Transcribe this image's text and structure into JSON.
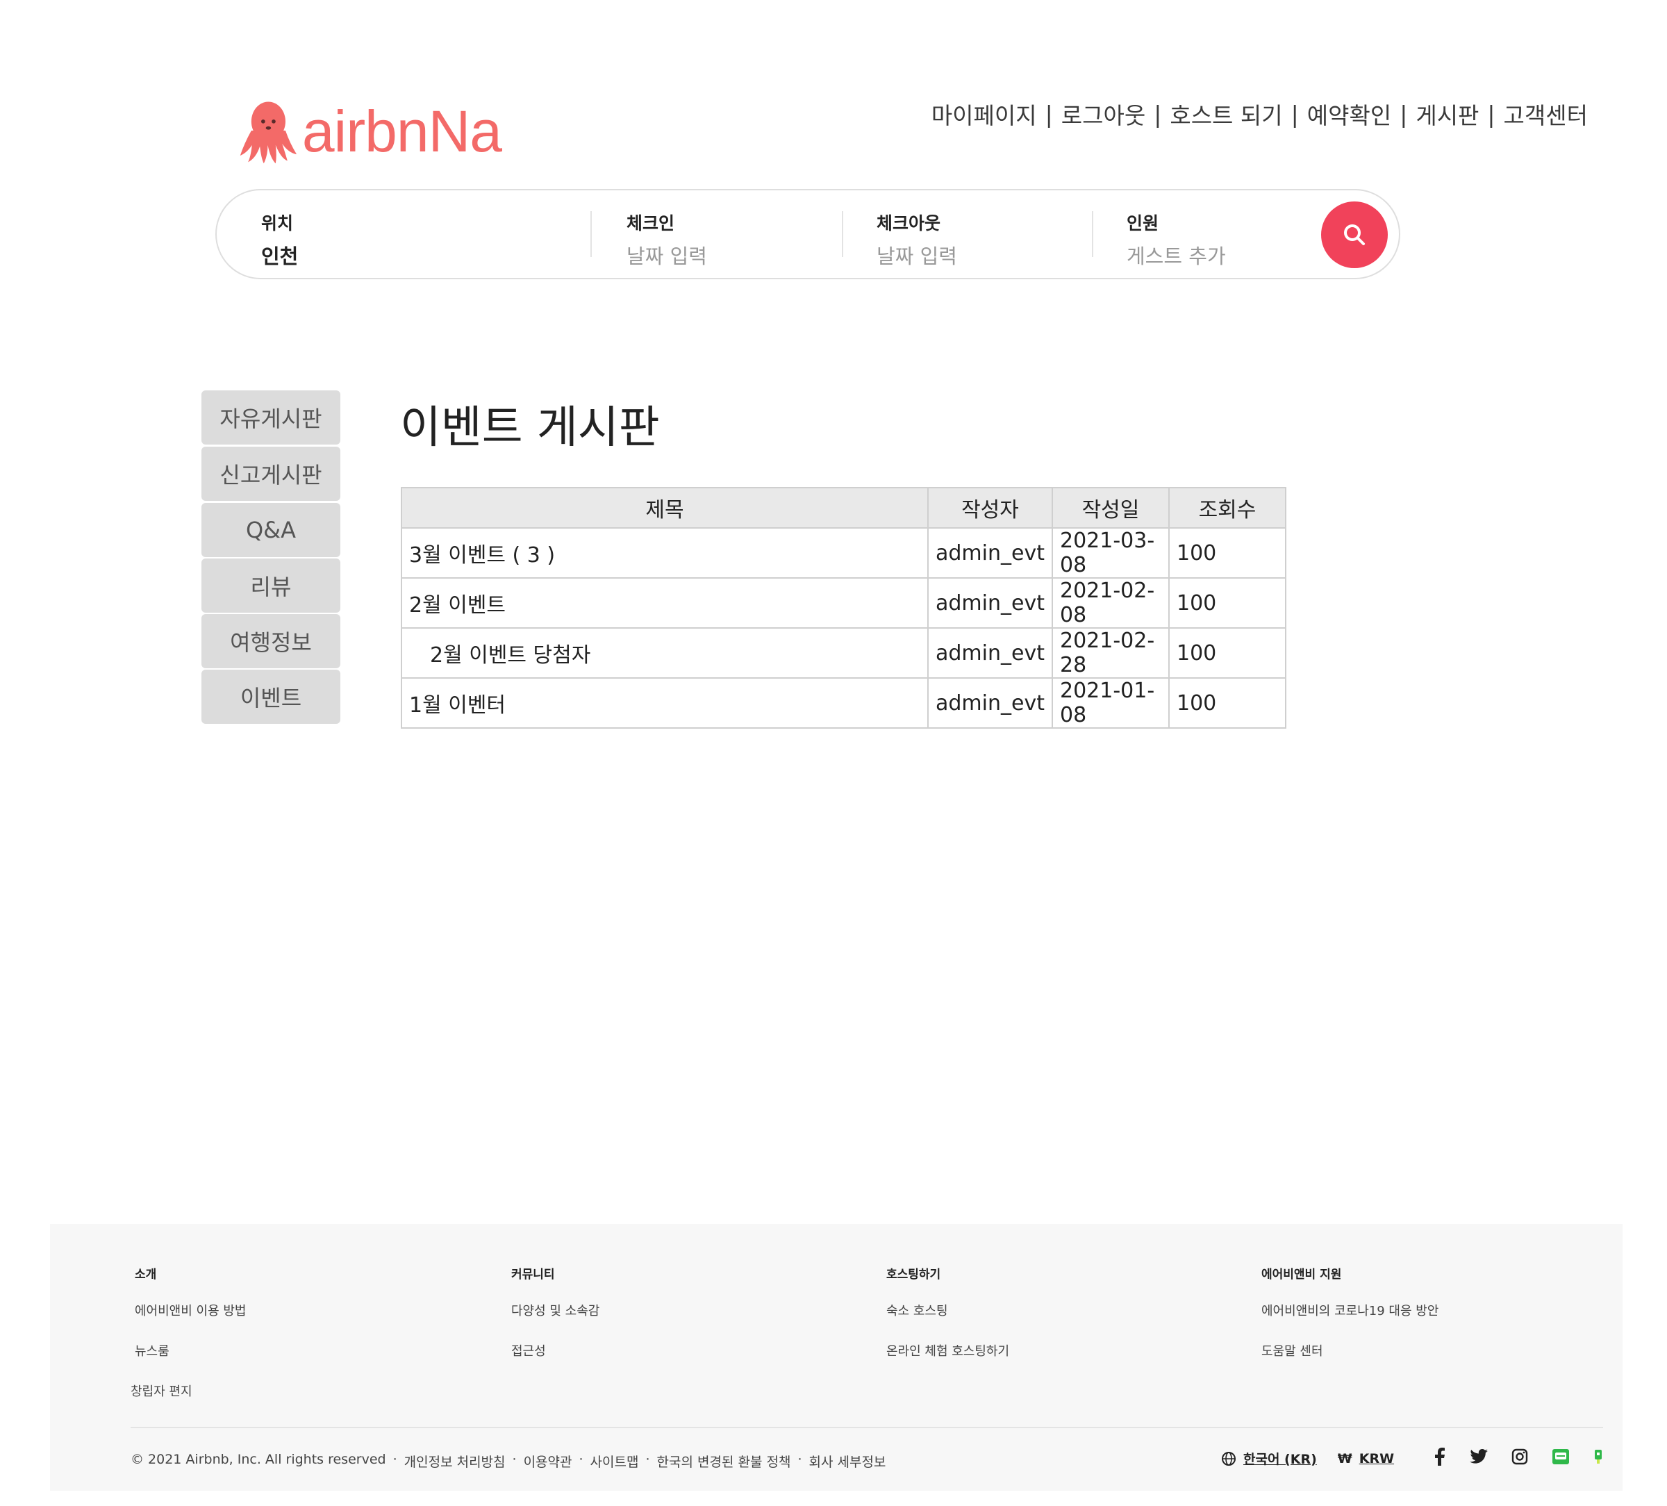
{
  "header": {
    "logo_text": "airbnNa",
    "nav": [
      "마이페이지",
      "로그아웃",
      "호스트 되기",
      "예약확인",
      "게시판",
      "고객센터"
    ],
    "separator": "|"
  },
  "search": {
    "location": {
      "label": "위치",
      "value": "인천"
    },
    "checkin": {
      "label": "체크인",
      "placeholder": "날짜 입력"
    },
    "checkout": {
      "label": "체크아웃",
      "placeholder": "날짜 입력"
    },
    "guests": {
      "label": "인원",
      "placeholder": "게스트 추가"
    },
    "button_icon": "search-icon",
    "accent": "#F1425A"
  },
  "sidebar": {
    "items": [
      "자유게시판",
      "신고게시판",
      "Q&A",
      "리뷰",
      "여행정보",
      "이벤트"
    ]
  },
  "board": {
    "title": "이벤트 게시판",
    "columns": [
      "제목",
      "작성자",
      "작성일",
      "조회수"
    ],
    "rows": [
      {
        "title": "3월 이벤트 ( 3 )",
        "author": "admin_evt",
        "date": "2021-03-08",
        "views": "100"
      },
      {
        "title": "2월 이벤트",
        "author": "admin_evt",
        "date": "2021-02-08",
        "views": "100"
      },
      {
        "title": "2월 이벤트 당첨자",
        "author": "admin_evt",
        "date": "2021-02-28",
        "views": "100"
      },
      {
        "title": "1월 이벤터",
        "author": "admin_evt",
        "date": "2021-01-08",
        "views": "100"
      }
    ]
  },
  "footer": {
    "columns": [
      {
        "heading": "소개",
        "links": [
          "에어비앤비 이용 방법",
          "뉴스룸",
          "창립자 편지"
        ]
      },
      {
        "heading": "커뮤니티",
        "links": [
          "다양성 및 소속감",
          "접근성"
        ]
      },
      {
        "heading": "호스팅하기",
        "links": [
          "숙소 호스팅",
          "온라인 체험 호스팅하기"
        ]
      },
      {
        "heading": "에어비앤비 지원",
        "links": [
          "에어비앤비의 코로나19 대응 방안",
          "도움말 센터"
        ]
      }
    ],
    "copyright": "© 2021 Airbnb, Inc. All rights reserved",
    "legal": [
      "개인정보 처리방침",
      "이용약관",
      "사이트맵",
      "한국의 변경된 환불 정책",
      "회사 세부정보"
    ],
    "dot": "·",
    "language": "한국어 (KR)",
    "currency_symbol": "₩",
    "currency": "KRW",
    "social_icons": [
      "facebook-icon",
      "twitter-icon",
      "instagram-icon",
      "line-icon",
      "naver-icon"
    ]
  }
}
